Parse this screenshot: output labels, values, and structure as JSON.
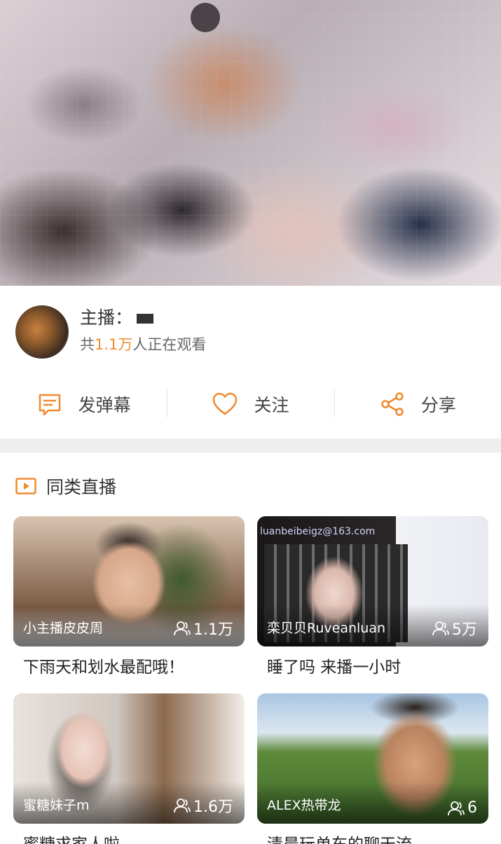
{
  "anchor": {
    "label": "主播：",
    "viewers_prefix": "共",
    "viewers_count": "1.1万",
    "viewers_suffix": "人正在观看"
  },
  "actions": [
    {
      "label": "发弹幕",
      "icon": "comment-icon"
    },
    {
      "label": "关注",
      "icon": "heart-icon"
    },
    {
      "label": "分享",
      "icon": "share-icon"
    }
  ],
  "section": {
    "title": "同类直播",
    "icon": "play-icon"
  },
  "cards": [
    {
      "anchor": "小主播皮皮周",
      "count": "1.1万",
      "title": "下雨天和划水最配哦！"
    },
    {
      "anchor": "栾贝贝Ruveanluan",
      "count": "5万",
      "title": "睡了吗 来播一小时",
      "overlay_email": "luanbeibeigz@163.com"
    },
    {
      "anchor": "蜜糖妹子m",
      "count": "1.6万",
      "title": "蜜糖求家人啦"
    },
    {
      "anchor": "ALEX热带龙",
      "count": "6",
      "title": "清晨玩单车的聊天流"
    }
  ],
  "colors": {
    "accent": "#f08a2c",
    "divider": "#eeeeee"
  }
}
